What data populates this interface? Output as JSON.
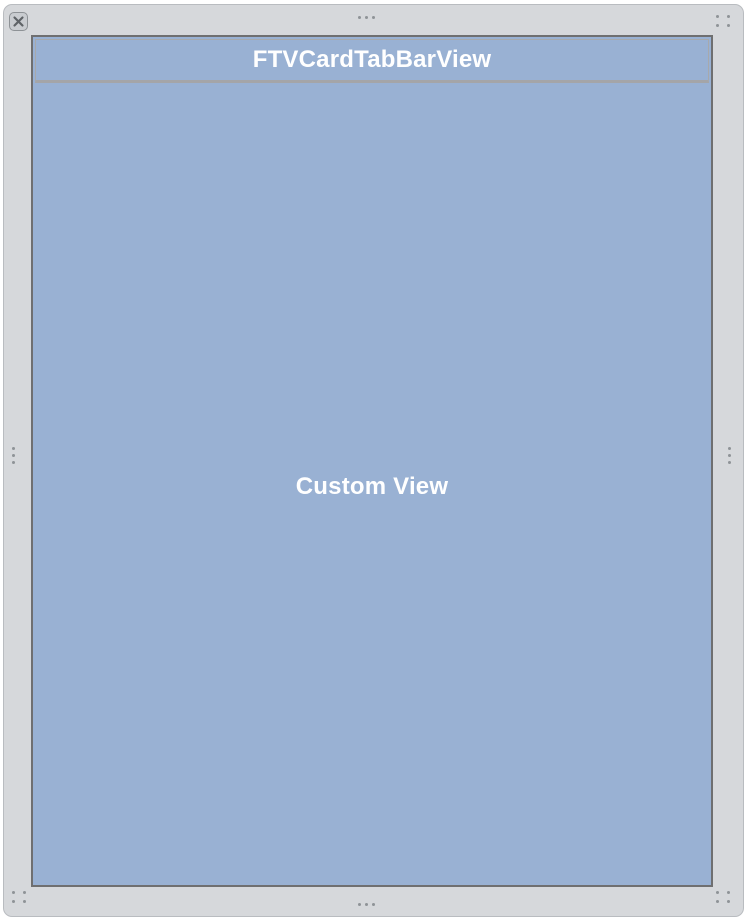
{
  "tab_bar_view": {
    "label": "FTVCardTabBarView"
  },
  "custom_view": {
    "label": "Custom View"
  },
  "colors": {
    "view_fill": "#99b1d3",
    "frame_background": "#d6d8db",
    "label_text": "#ffffff",
    "view_border": "#6f6f70"
  },
  "icons": {
    "close": "close-icon",
    "resize_handles": "grip-dots-icon"
  }
}
